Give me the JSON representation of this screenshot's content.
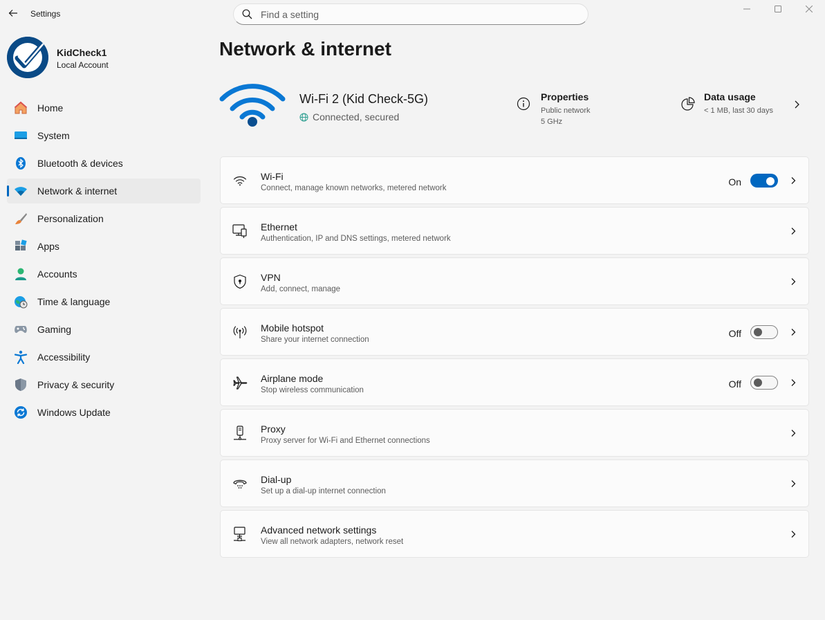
{
  "app": {
    "title": "Settings"
  },
  "search": {
    "placeholder": "Find a setting"
  },
  "account": {
    "name": "KidCheck1",
    "type": "Local Account"
  },
  "nav": {
    "items": [
      {
        "label": "Home",
        "icon": "home-icon"
      },
      {
        "label": "System",
        "icon": "system-icon"
      },
      {
        "label": "Bluetooth & devices",
        "icon": "bluetooth-icon"
      },
      {
        "label": "Network & internet",
        "icon": "network-icon",
        "active": true
      },
      {
        "label": "Personalization",
        "icon": "brush-icon"
      },
      {
        "label": "Apps",
        "icon": "apps-icon"
      },
      {
        "label": "Accounts",
        "icon": "accounts-icon"
      },
      {
        "label": "Time & language",
        "icon": "globe-clock-icon"
      },
      {
        "label": "Gaming",
        "icon": "gamepad-icon"
      },
      {
        "label": "Accessibility",
        "icon": "accessibility-icon"
      },
      {
        "label": "Privacy & security",
        "icon": "shield-icon"
      },
      {
        "label": "Windows Update",
        "icon": "update-icon"
      }
    ]
  },
  "page": {
    "title": "Network & internet"
  },
  "hero": {
    "network_name": "Wi-Fi 2 (Kid Check-5G)",
    "status": "Connected, secured",
    "properties": {
      "title": "Properties",
      "line1": "Public network",
      "line2": "5 GHz"
    },
    "data_usage": {
      "title": "Data usage",
      "line1": "< 1 MB, last 30 days"
    }
  },
  "cards": [
    {
      "title": "Wi-Fi",
      "subtitle": "Connect, manage known networks, metered network",
      "icon": "wifi-icon",
      "state": "On"
    },
    {
      "title": "Ethernet",
      "subtitle": "Authentication, IP and DNS settings, metered network",
      "icon": "ethernet-icon"
    },
    {
      "title": "VPN",
      "subtitle": "Add, connect, manage",
      "icon": "vpn-shield-icon"
    },
    {
      "title": "Mobile hotspot",
      "subtitle": "Share your internet connection",
      "icon": "hotspot-icon",
      "state": "Off"
    },
    {
      "title": "Airplane mode",
      "subtitle": "Stop wireless communication",
      "icon": "airplane-icon",
      "state": "Off"
    },
    {
      "title": "Proxy",
      "subtitle": "Proxy server for Wi-Fi and Ethernet connections",
      "icon": "proxy-icon"
    },
    {
      "title": "Dial-up",
      "subtitle": "Set up a dial-up internet connection",
      "icon": "dialup-icon"
    },
    {
      "title": "Advanced network settings",
      "subtitle": "View all network adapters, network reset",
      "icon": "advanced-network-icon"
    }
  ],
  "colors": {
    "accent": "#0067c0",
    "background": "#f3f3f3",
    "card": "#fbfbfb"
  }
}
